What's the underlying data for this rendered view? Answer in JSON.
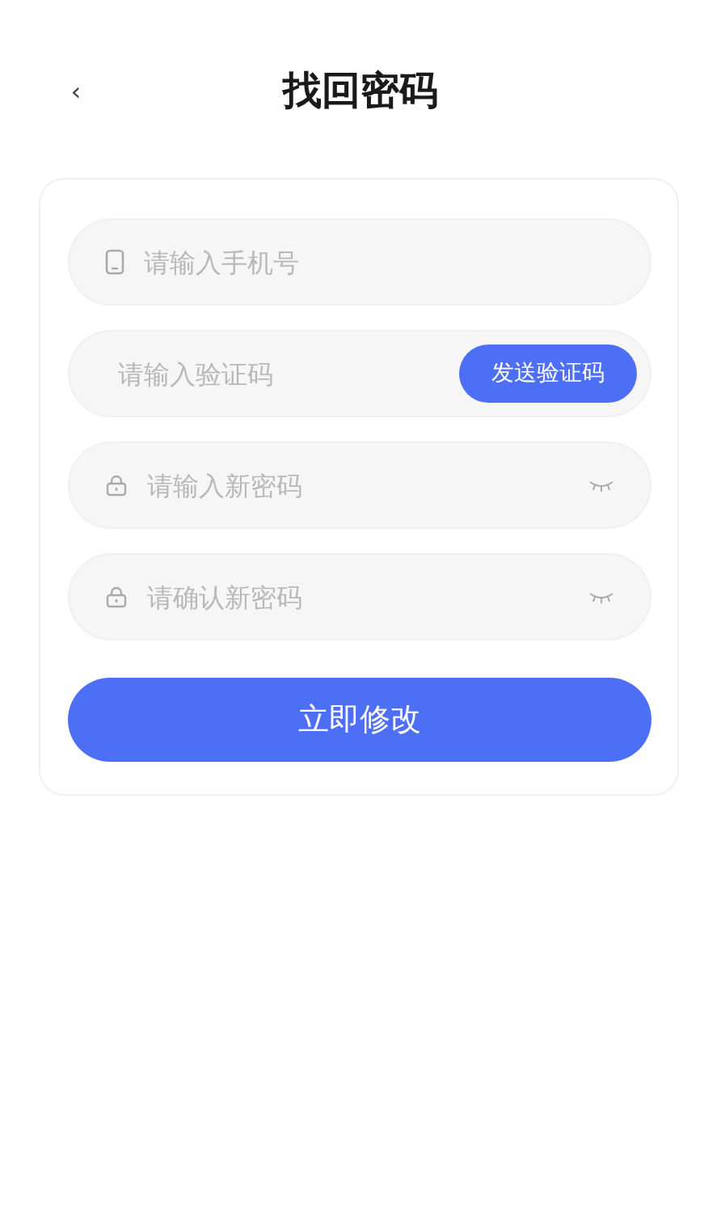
{
  "header": {
    "back": "‹",
    "title": "找回密码"
  },
  "fields": [
    {
      "kind": "phone",
      "placeholder": "请输入手机号"
    },
    {
      "kind": "code",
      "placeholder": "请输入验证码",
      "button": "发送验证码"
    },
    {
      "kind": "password",
      "placeholder": "请输入新密码"
    },
    {
      "kind": "password",
      "placeholder": "请确认新密码"
    }
  ],
  "submit": "立即修改"
}
